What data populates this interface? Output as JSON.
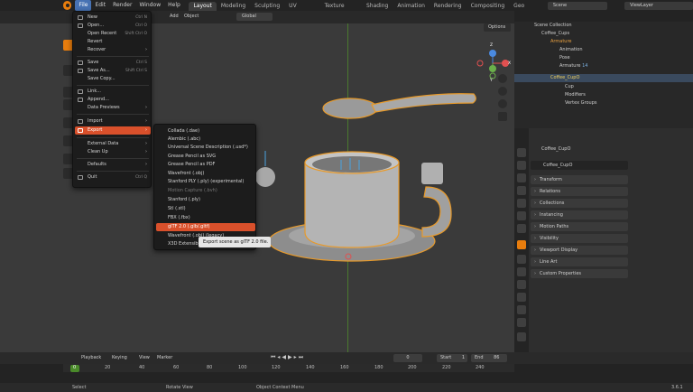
{
  "topbar": {
    "menus": [
      "File",
      "Edit",
      "Render",
      "Window",
      "Help"
    ],
    "workspaces": [
      "Layout",
      "Modeling",
      "Sculpting",
      "UV Editing",
      "Texture Paint",
      "Shading",
      "Animation",
      "Rendering",
      "Compositing",
      "Geo"
    ],
    "scene": "Scene",
    "view_layer": "ViewLayer"
  },
  "viewport": {
    "header_items": [
      "ect",
      "Add",
      "Object"
    ],
    "orientation": "Global",
    "options": "Options",
    "gizmo": {
      "x": "X",
      "y": "Y",
      "z": "Z"
    }
  },
  "file_menu": {
    "items": [
      {
        "label": "New",
        "shortcut": "Ctrl N",
        "arrow": true
      },
      {
        "label": "Open...",
        "shortcut": "Ctrl O"
      },
      {
        "label": "Open Recent",
        "shortcut": "Shift Ctrl O",
        "arrow": true
      },
      {
        "label": "Revert",
        "shortcut": ""
      },
      {
        "label": "Recover",
        "shortcut": "",
        "arrow": true
      },
      {
        "label": "Save",
        "shortcut": "Ctrl S"
      },
      {
        "label": "Save As...",
        "shortcut": "Shift Ctrl S"
      },
      {
        "label": "Save Copy...",
        "shortcut": ""
      },
      {
        "label": "Link...",
        "shortcut": ""
      },
      {
        "label": "Append...",
        "shortcut": ""
      },
      {
        "label": "Data Previews",
        "shortcut": "",
        "arrow": true
      },
      {
        "label": "Import",
        "shortcut": "",
        "arrow": true
      },
      {
        "label": "Export",
        "shortcut": "",
        "arrow": true
      },
      {
        "label": "External Data",
        "shortcut": "",
        "arrow": true
      },
      {
        "label": "Clean Up",
        "shortcut": "",
        "arrow": true
      },
      {
        "label": "Defaults",
        "shortcut": "",
        "arrow": true
      },
      {
        "label": "Quit",
        "shortcut": "Ctrl Q"
      }
    ]
  },
  "export_menu": {
    "items": [
      "Collada (.dae)",
      "Alembic (.abc)",
      "Universal Scene Description (.usd*)",
      "Grease Pencil as SVG",
      "Grease Pencil as PDF",
      "Wavefront (.obj)",
      "Stanford PLY (.ply) (experimental)",
      "Motion Capture (.bvh)",
      "Stanford (.ply)",
      "Stl (.stl)",
      "FBX (.fbx)",
      "glTF 2.0 (.glb/.gltf)",
      "Wavefront (.obj) (legacy)",
      "X3D Extensible 3D (.x3d)"
    ],
    "tooltip": "Export scene as glTF 2.0 file."
  },
  "outliner": {
    "rows": [
      "Scene Collection",
      "Coffee_Cups",
      "Armature",
      "Animation",
      "Pose",
      "Armature",
      "Coffee_CupO",
      "Cup",
      "Modifiers",
      "Vertex Groups"
    ],
    "badge": "14"
  },
  "properties": {
    "object_name": "Coffee_CupO",
    "data_name": "Coffee_CupO",
    "panels": [
      "Transform",
      "Relations",
      "Collections",
      "Instancing",
      "Motion Paths",
      "Visibility",
      "Viewport Display",
      "Line Art",
      "Custom Properties"
    ]
  },
  "timeline": {
    "menus": [
      "Playback",
      "Keying",
      "View",
      "Marker"
    ],
    "current_frame": "0",
    "start_label": "Start",
    "start": "1",
    "end_label": "End",
    "end": "86",
    "ticks": [
      "0",
      "20",
      "40",
      "60",
      "80",
      "100",
      "120",
      "140",
      "160",
      "180",
      "200",
      "220",
      "240"
    ]
  },
  "statusbar": {
    "select": "Select",
    "rotate": "Rotate View",
    "context": "Object Context Menu",
    "version": "3.6.1"
  }
}
